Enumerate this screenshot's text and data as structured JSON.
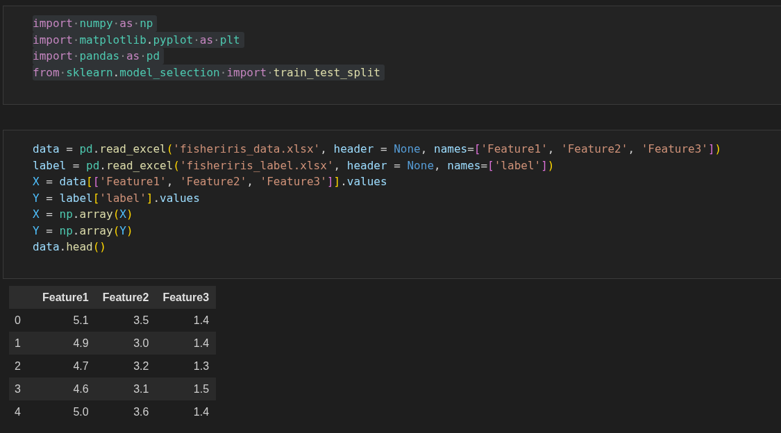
{
  "cells": [
    {
      "lines": [
        {
          "highlighted": true,
          "tokens": [
            {
              "kind": "keyword",
              "text": "import"
            },
            {
              "kind": "ws",
              "text": "·"
            },
            {
              "kind": "module",
              "text": "numpy"
            },
            {
              "kind": "ws",
              "text": "·"
            },
            {
              "kind": "keyword",
              "text": "as"
            },
            {
              "kind": "ws",
              "text": "·"
            },
            {
              "kind": "module",
              "text": "np"
            }
          ]
        },
        {
          "highlighted": true,
          "tokens": [
            {
              "kind": "keyword",
              "text": "import"
            },
            {
              "kind": "ws",
              "text": "·"
            },
            {
              "kind": "module",
              "text": "matplotlib"
            },
            {
              "kind": "plain",
              "text": "."
            },
            {
              "kind": "module",
              "text": "pyplot"
            },
            {
              "kind": "ws",
              "text": "·"
            },
            {
              "kind": "keyword",
              "text": "as"
            },
            {
              "kind": "ws",
              "text": "·"
            },
            {
              "kind": "module",
              "text": "plt"
            }
          ]
        },
        {
          "highlighted": true,
          "tokens": [
            {
              "kind": "keyword",
              "text": "import"
            },
            {
              "kind": "ws",
              "text": "·"
            },
            {
              "kind": "module",
              "text": "pandas"
            },
            {
              "kind": "ws",
              "text": "·"
            },
            {
              "kind": "keyword",
              "text": "as"
            },
            {
              "kind": "ws",
              "text": "·"
            },
            {
              "kind": "module",
              "text": "pd"
            }
          ]
        },
        {
          "highlighted": true,
          "tokens": [
            {
              "kind": "keyword",
              "text": "from"
            },
            {
              "kind": "ws",
              "text": "·"
            },
            {
              "kind": "module",
              "text": "sklearn"
            },
            {
              "kind": "plain",
              "text": "."
            },
            {
              "kind": "module",
              "text": "model_selection"
            },
            {
              "kind": "ws",
              "text": "·"
            },
            {
              "kind": "keyword",
              "text": "import"
            },
            {
              "kind": "ws",
              "text": "·"
            },
            {
              "kind": "func",
              "text": "train_test_split"
            }
          ]
        }
      ]
    },
    {
      "lines": [
        {
          "highlighted": false,
          "tokens": [
            {
              "kind": "var",
              "text": "data"
            },
            {
              "kind": "plain",
              "text": " = "
            },
            {
              "kind": "module",
              "text": "pd"
            },
            {
              "kind": "plain",
              "text": "."
            },
            {
              "kind": "func",
              "text": "read_excel"
            },
            {
              "kind": "bracket1",
              "text": "("
            },
            {
              "kind": "string",
              "text": "'fisheriris_data.xlsx'"
            },
            {
              "kind": "plain",
              "text": ", "
            },
            {
              "kind": "var",
              "text": "header"
            },
            {
              "kind": "plain",
              "text": " = "
            },
            {
              "kind": "const",
              "text": "None"
            },
            {
              "kind": "plain",
              "text": ", "
            },
            {
              "kind": "var",
              "text": "names"
            },
            {
              "kind": "plain",
              "text": "="
            },
            {
              "kind": "bracket2",
              "text": "["
            },
            {
              "kind": "string",
              "text": "'Feature1'"
            },
            {
              "kind": "plain",
              "text": ", "
            },
            {
              "kind": "string",
              "text": "'Feature2'"
            },
            {
              "kind": "plain",
              "text": ", "
            },
            {
              "kind": "string",
              "text": "'Feature3'"
            },
            {
              "kind": "bracket2",
              "text": "]"
            },
            {
              "kind": "bracket1",
              "text": ")"
            }
          ]
        },
        {
          "highlighted": false,
          "tokens": [
            {
              "kind": "var",
              "text": "label"
            },
            {
              "kind": "plain",
              "text": " = "
            },
            {
              "kind": "module",
              "text": "pd"
            },
            {
              "kind": "plain",
              "text": "."
            },
            {
              "kind": "func",
              "text": "read_excel"
            },
            {
              "kind": "bracket1",
              "text": "("
            },
            {
              "kind": "string",
              "text": "'fisheriris_label.xlsx'"
            },
            {
              "kind": "plain",
              "text": ", "
            },
            {
              "kind": "var",
              "text": "header"
            },
            {
              "kind": "plain",
              "text": " = "
            },
            {
              "kind": "const",
              "text": "None"
            },
            {
              "kind": "plain",
              "text": ", "
            },
            {
              "kind": "var",
              "text": "names"
            },
            {
              "kind": "plain",
              "text": "="
            },
            {
              "kind": "bracket2",
              "text": "["
            },
            {
              "kind": "string",
              "text": "'label'"
            },
            {
              "kind": "bracket2",
              "text": "]"
            },
            {
              "kind": "bracket1",
              "text": ")"
            }
          ]
        },
        {
          "highlighted": false,
          "tokens": [
            {
              "kind": "constvar",
              "text": "X"
            },
            {
              "kind": "plain",
              "text": " = "
            },
            {
              "kind": "var",
              "text": "data"
            },
            {
              "kind": "bracket1",
              "text": "["
            },
            {
              "kind": "bracket2",
              "text": "["
            },
            {
              "kind": "string",
              "text": "'Feature1'"
            },
            {
              "kind": "plain",
              "text": ", "
            },
            {
              "kind": "string",
              "text": "'Feature2'"
            },
            {
              "kind": "plain",
              "text": ", "
            },
            {
              "kind": "string",
              "text": "'Feature3'"
            },
            {
              "kind": "bracket2",
              "text": "]"
            },
            {
              "kind": "bracket1",
              "text": "]"
            },
            {
              "kind": "plain",
              "text": "."
            },
            {
              "kind": "var",
              "text": "values"
            }
          ]
        },
        {
          "highlighted": false,
          "tokens": [
            {
              "kind": "constvar",
              "text": "Y"
            },
            {
              "kind": "plain",
              "text": " = "
            },
            {
              "kind": "var",
              "text": "label"
            },
            {
              "kind": "bracket1",
              "text": "["
            },
            {
              "kind": "string",
              "text": "'label'"
            },
            {
              "kind": "bracket1",
              "text": "]"
            },
            {
              "kind": "plain",
              "text": "."
            },
            {
              "kind": "var",
              "text": "values"
            }
          ]
        },
        {
          "highlighted": false,
          "tokens": [
            {
              "kind": "constvar",
              "text": "X"
            },
            {
              "kind": "plain",
              "text": " = "
            },
            {
              "kind": "module",
              "text": "np"
            },
            {
              "kind": "plain",
              "text": "."
            },
            {
              "kind": "func",
              "text": "array"
            },
            {
              "kind": "bracket1",
              "text": "("
            },
            {
              "kind": "constvar",
              "text": "X"
            },
            {
              "kind": "bracket1",
              "text": ")"
            }
          ]
        },
        {
          "highlighted": false,
          "tokens": [
            {
              "kind": "constvar",
              "text": "Y"
            },
            {
              "kind": "plain",
              "text": " = "
            },
            {
              "kind": "module",
              "text": "np"
            },
            {
              "kind": "plain",
              "text": "."
            },
            {
              "kind": "func",
              "text": "array"
            },
            {
              "kind": "bracket1",
              "text": "("
            },
            {
              "kind": "constvar",
              "text": "Y"
            },
            {
              "kind": "bracket1",
              "text": ")"
            }
          ]
        },
        {
          "highlighted": false,
          "tokens": [
            {
              "kind": "var",
              "text": "data"
            },
            {
              "kind": "plain",
              "text": "."
            },
            {
              "kind": "func",
              "text": "head"
            },
            {
              "kind": "bracket1",
              "text": "("
            },
            {
              "kind": "bracket1",
              "text": ")"
            }
          ]
        }
      ]
    }
  ],
  "output_table": {
    "columns": [
      "",
      "Feature1",
      "Feature2",
      "Feature3"
    ],
    "rows": [
      [
        "0",
        "5.1",
        "3.5",
        "1.4"
      ],
      [
        "1",
        "4.9",
        "3.0",
        "1.4"
      ],
      [
        "2",
        "4.7",
        "3.2",
        "1.3"
      ],
      [
        "3",
        "4.6",
        "3.1",
        "1.5"
      ],
      [
        "4",
        "5.0",
        "3.6",
        "1.4"
      ]
    ]
  }
}
